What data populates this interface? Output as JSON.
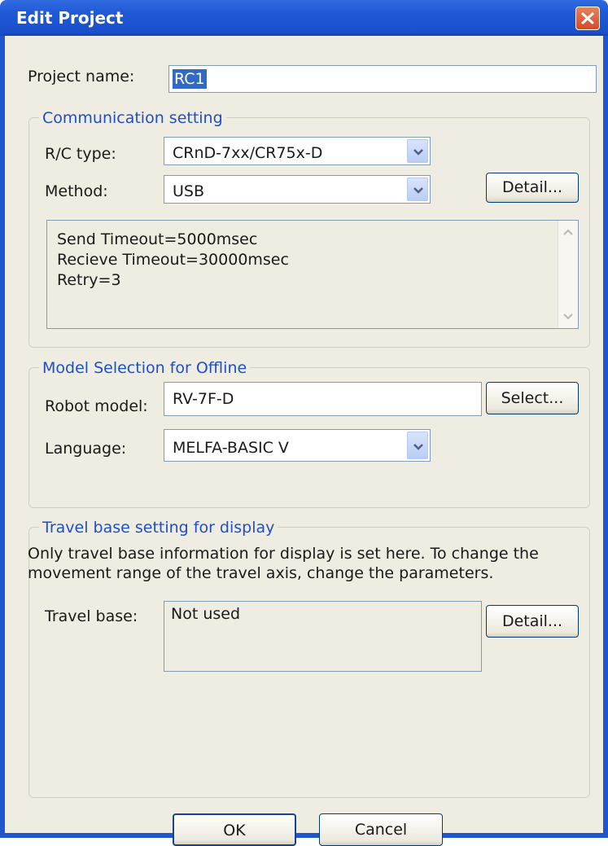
{
  "window": {
    "title": "Edit Project"
  },
  "project": {
    "label": "Project name:",
    "value": "RC1"
  },
  "communication": {
    "group_title": "Communication setting",
    "rc_type_label": "R/C type:",
    "rc_type_value": "CRnD-7xx/CR75x-D",
    "method_label": "Method:",
    "method_value": "USB",
    "detail_button": "Detail...",
    "info_lines": [
      "Send Timeout=5000msec",
      "Recieve Timeout=30000msec",
      "Retry=3"
    ]
  },
  "model": {
    "group_title": "Model Selection for Offline",
    "robot_label": "Robot model:",
    "robot_value": "RV-7F-D",
    "select_button": "Select...",
    "language_label": "Language:",
    "language_value": "MELFA-BASIC V"
  },
  "travel": {
    "group_title": "Travel base setting for display",
    "description_line1": "Only travel base information for display is set here. To change the",
    "description_line2": "movement range of the travel axis, change the parameters.",
    "base_label": "Travel base:",
    "base_value": "Not used",
    "detail_button": "Detail..."
  },
  "footer": {
    "ok_button": "OK",
    "cancel_button": "Cancel"
  },
  "colors": {
    "titlebar": "#1f58d6",
    "dialog_bg": "#efede2",
    "group_title": "#1f4fc8",
    "close_button": "#d24b24"
  },
  "icons": {
    "close": "close-icon",
    "dropdown": "chevron-down-icon",
    "scroll_up": "scroll-up-arrow-icon",
    "scroll_down": "scroll-down-arrow-icon"
  }
}
